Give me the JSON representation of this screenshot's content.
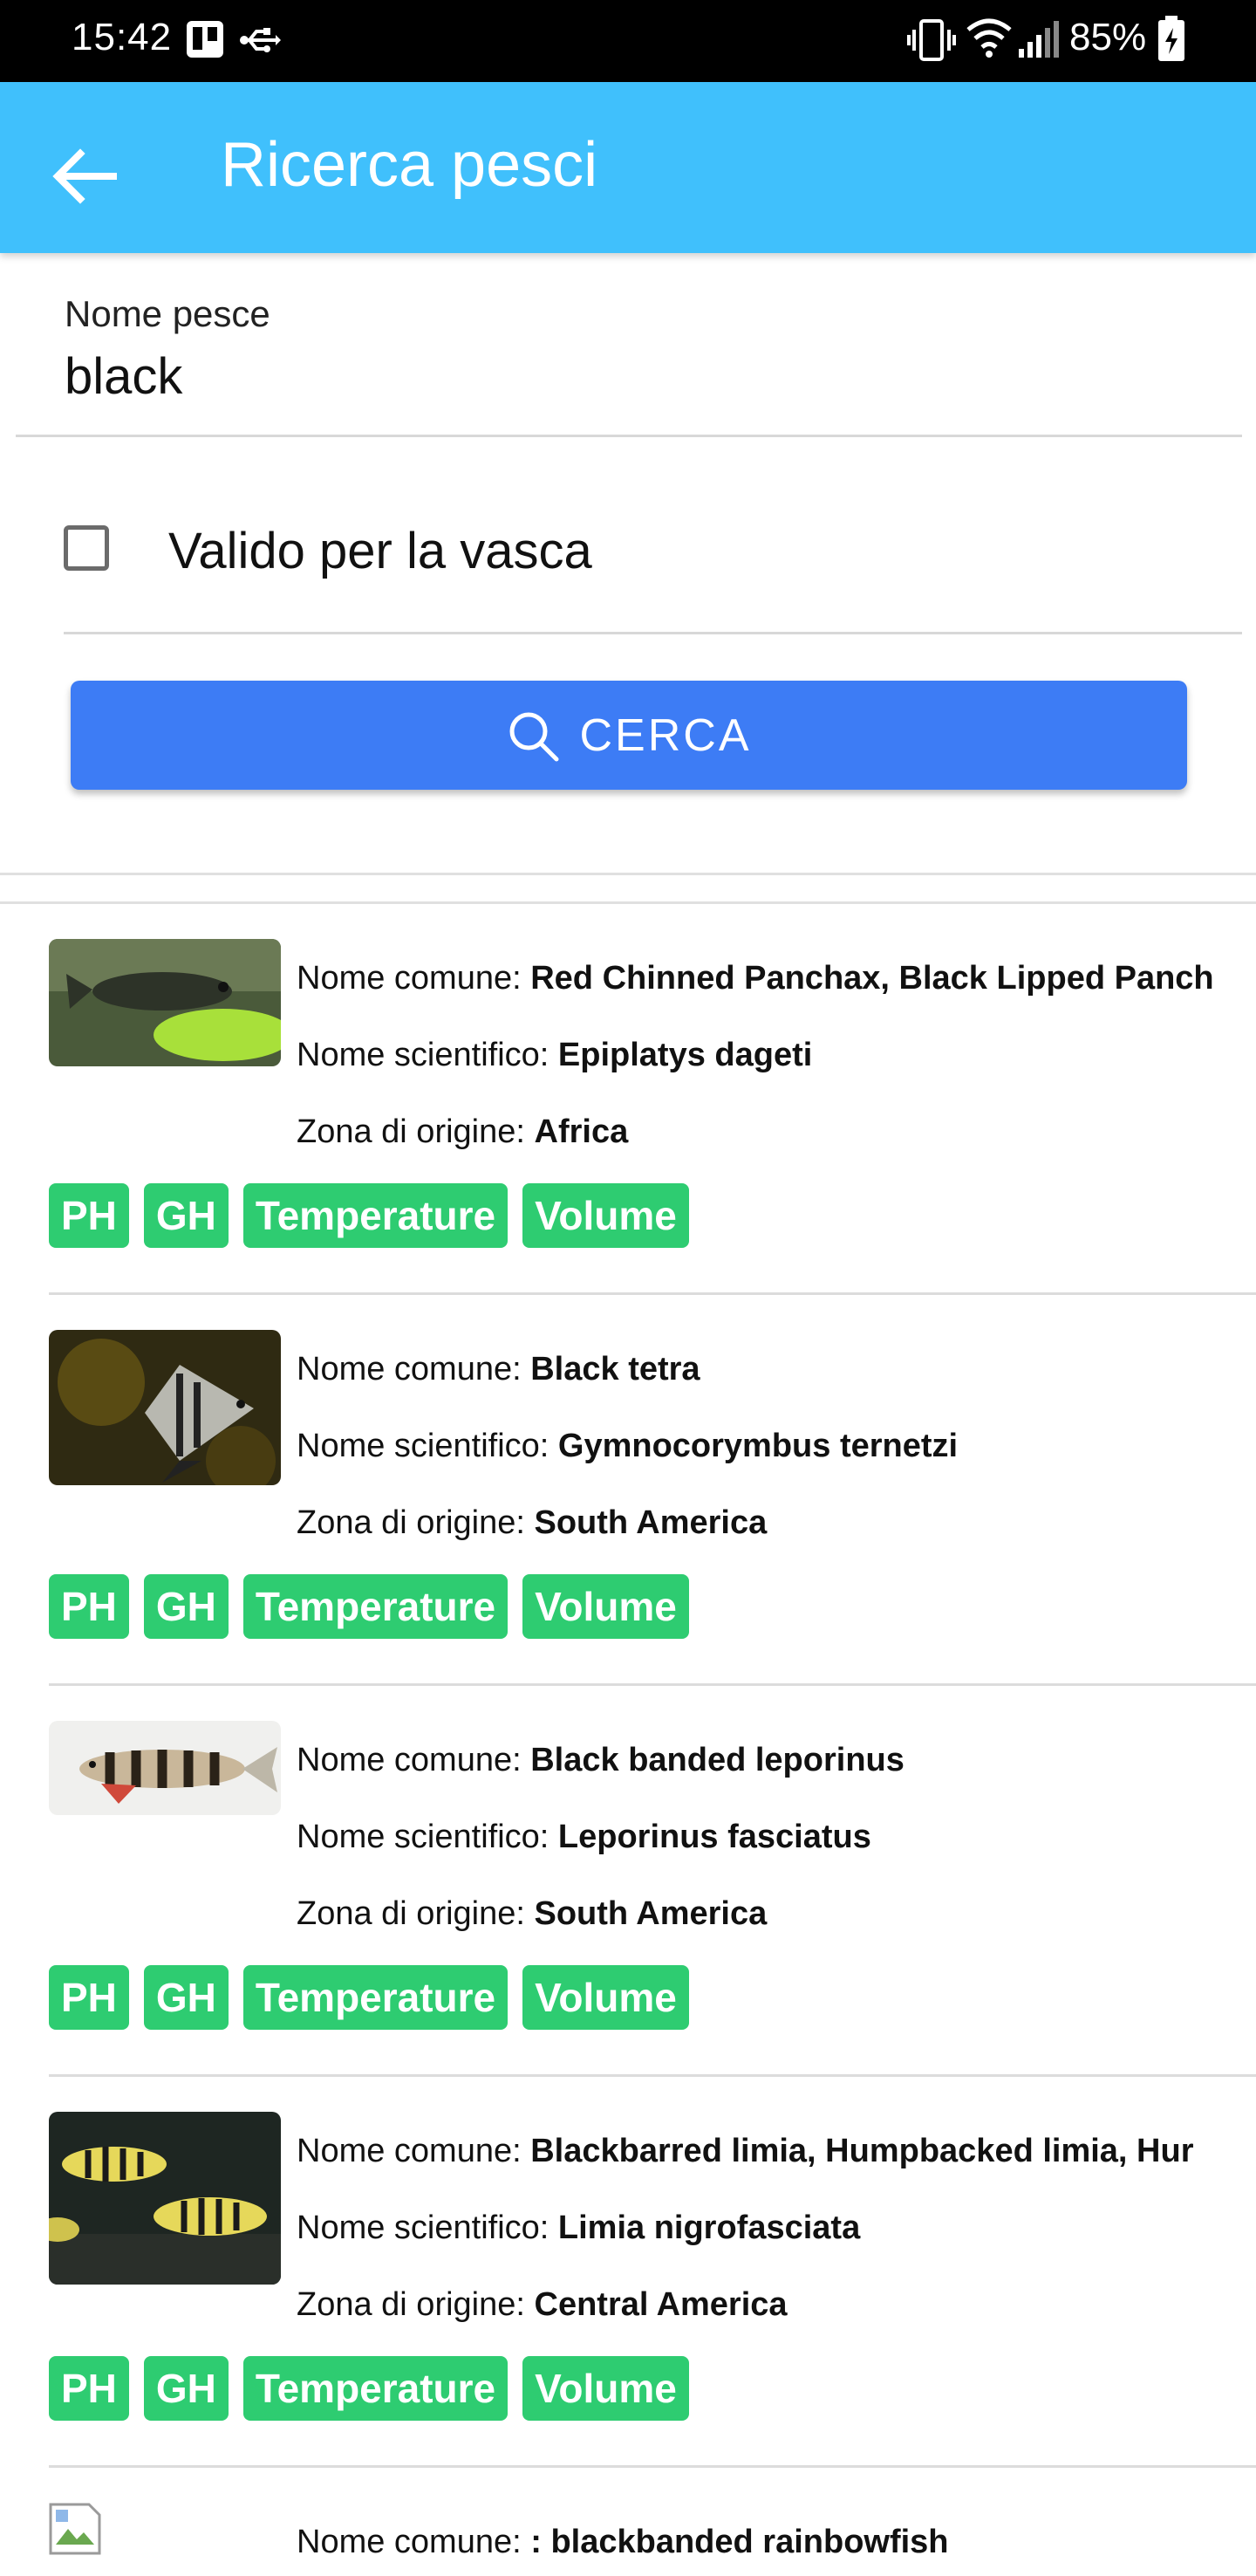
{
  "status_bar": {
    "time": "15:42",
    "battery": "85%",
    "icons": [
      "trello-icon",
      "usb-icon",
      "vibrate-icon",
      "wifi-icon",
      "signal-icon",
      "battery-charging-icon"
    ]
  },
  "app_bar": {
    "title": "Ricerca pesci",
    "back_icon": "arrow-back-icon"
  },
  "search": {
    "label": "Nome pesce",
    "value": "black",
    "checkbox_label": "Valido per la vasca",
    "checkbox_checked": false,
    "button_label": "CERCA",
    "button_icon": "search-icon"
  },
  "labels": {
    "common": "Nome comune: ",
    "scientific": "Nome scientifico: ",
    "origin": "Zona di origine: "
  },
  "results": [
    {
      "common_name": "Red Chinned Panchax, Black Lipped Panchax",
      "scientific_name": "Epiplatys dageti",
      "origin": "Africa",
      "tags": [
        "PH",
        "GH",
        "Temperature",
        "Volume"
      ]
    },
    {
      "common_name": "Black tetra",
      "scientific_name": "Gymnocorymbus ternetzi",
      "origin": "South America",
      "tags": [
        "PH",
        "GH",
        "Temperature",
        "Volume"
      ]
    },
    {
      "common_name": "Black banded leporinus",
      "scientific_name": "Leporinus fasciatus",
      "origin": "South America",
      "tags": [
        "PH",
        "GH",
        "Temperature",
        "Volume"
      ]
    },
    {
      "common_name": "Blackbarred limia, Humpbacked limia, Hur",
      "scientific_name": "Limia nigrofasciata",
      "origin": "Central America",
      "tags": [
        "PH",
        "GH",
        "Temperature",
        "Volume"
      ]
    },
    {
      "common_name": ": blackbanded rainbowfish"
    }
  ],
  "colors": {
    "app_bar": "#40c0fc",
    "button": "#3d7cf5",
    "tag": "#2ecc71"
  }
}
